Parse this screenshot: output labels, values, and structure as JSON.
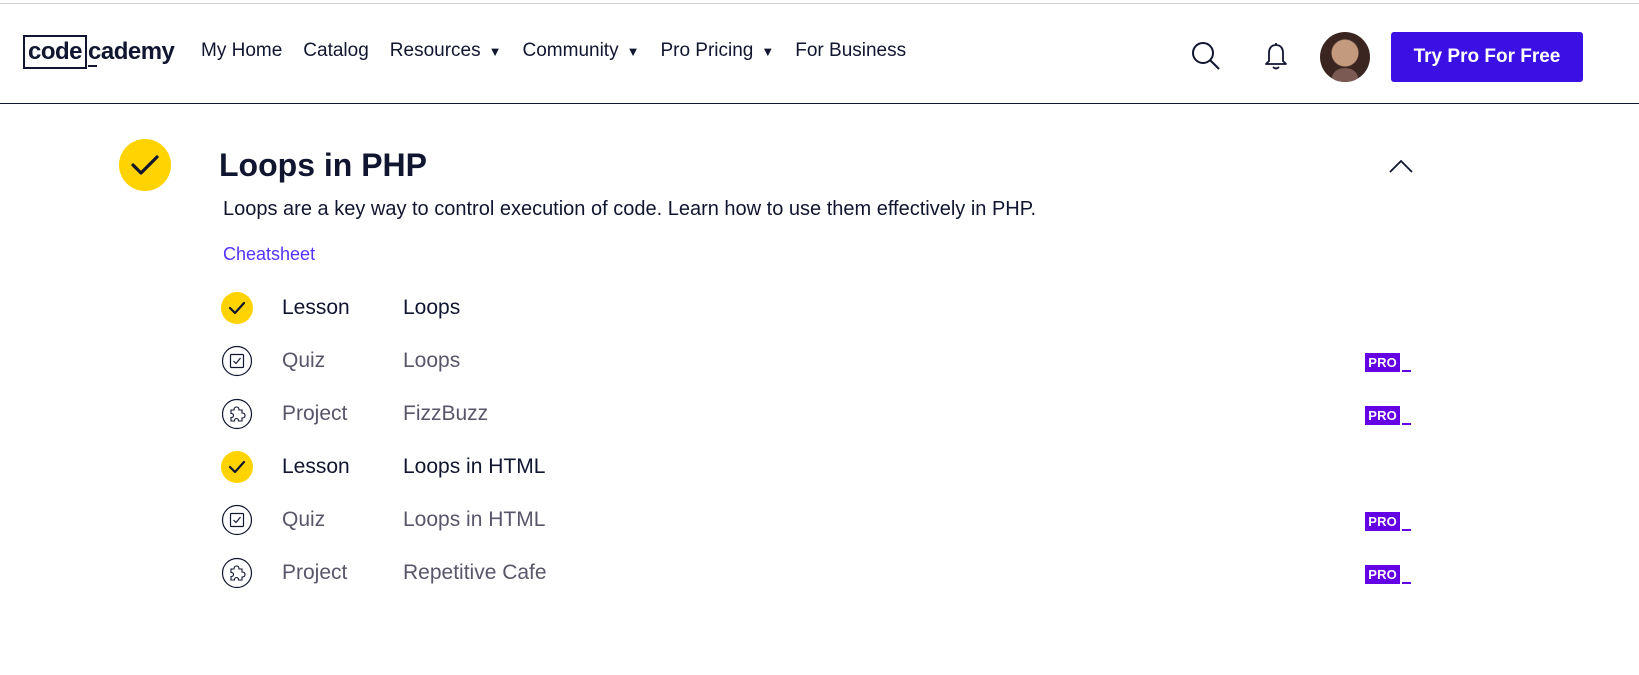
{
  "header": {
    "logo": {
      "part1": "code",
      "part2": "cademy"
    },
    "nav": [
      {
        "label": "My Home",
        "has_caret": false
      },
      {
        "label": "Catalog",
        "has_caret": false
      },
      {
        "label": "Resources",
        "has_caret": true
      },
      {
        "label": "Community",
        "has_caret": true
      },
      {
        "label": "Pro Pricing",
        "has_caret": true
      },
      {
        "label": "For Business",
        "has_caret": false
      }
    ],
    "cta_label": "Try Pro For Free"
  },
  "module": {
    "title": "Loops in PHP",
    "description": "Loops are a key way to control execution of code. Learn how to use them effectively in PHP.",
    "cheatsheet_label": "Cheatsheet",
    "items": [
      {
        "type": "Lesson",
        "name": "Loops",
        "status": "completed",
        "icon": "check-icon",
        "pro": false
      },
      {
        "type": "Quiz",
        "name": "Loops",
        "status": "locked",
        "icon": "quiz-icon",
        "pro": true
      },
      {
        "type": "Project",
        "name": "FizzBuzz",
        "status": "locked",
        "icon": "puzzle-icon",
        "pro": true
      },
      {
        "type": "Lesson",
        "name": "Loops in HTML",
        "status": "completed",
        "icon": "check-icon",
        "pro": false
      },
      {
        "type": "Quiz",
        "name": "Loops in HTML",
        "status": "locked",
        "icon": "quiz-icon",
        "pro": true
      },
      {
        "type": "Project",
        "name": "Repetitive Cafe",
        "status": "locked",
        "icon": "puzzle-icon",
        "pro": true
      }
    ],
    "pro_badge_label": "PRO"
  },
  "colors": {
    "brand_dark": "#10162f",
    "cta": "#3a10e5",
    "check_yellow": "#ffd300",
    "pro_purple": "#6400e4",
    "link": "#5533ff"
  }
}
